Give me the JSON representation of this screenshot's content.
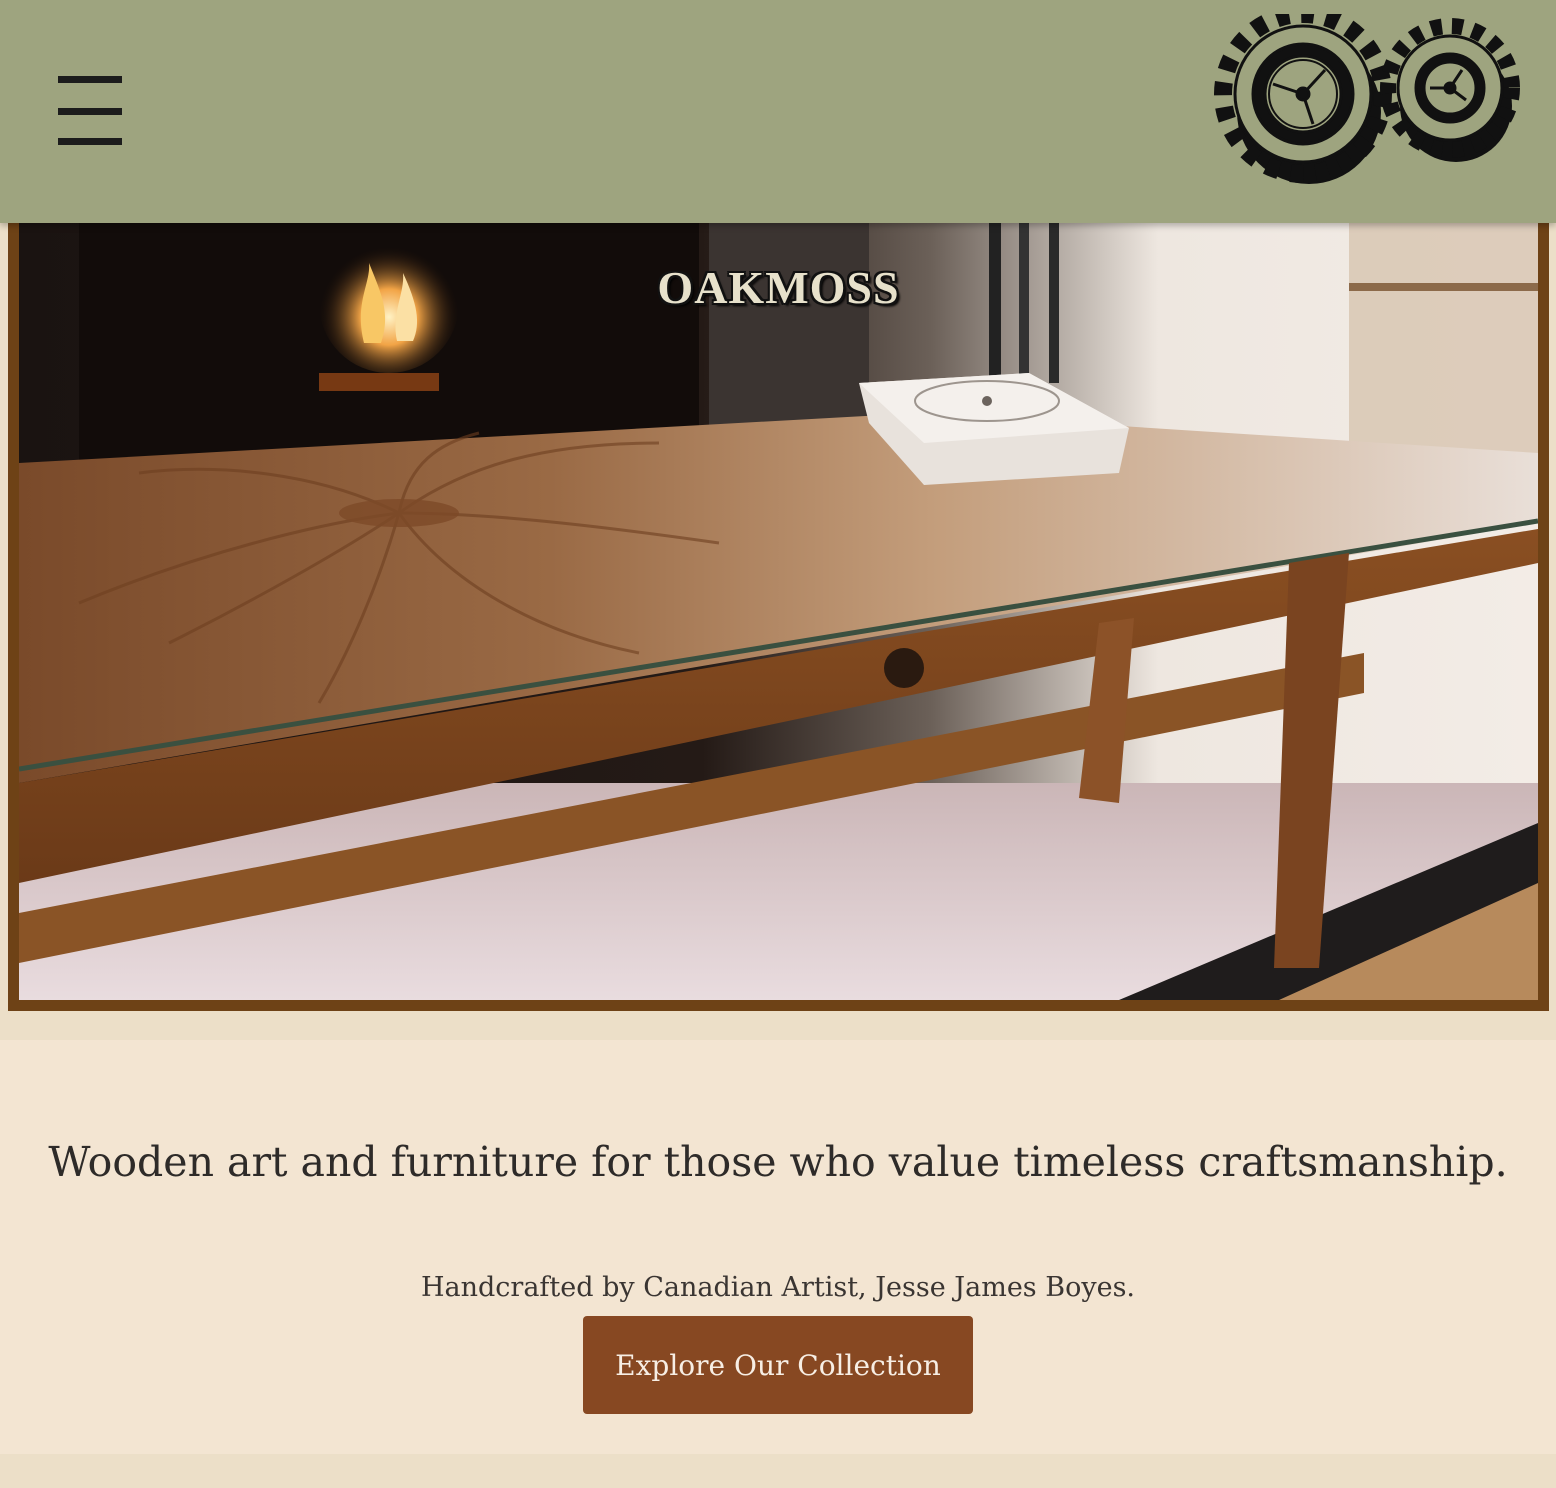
{
  "header": {
    "menu_icon": "hamburger-menu-icon",
    "logo_icon": "gears-logo-icon",
    "background_color": "#9ea47f"
  },
  "hero": {
    "title": "OAKMOSS",
    "image_description_icon": "coffee-table-photo",
    "frame_color": "#6e4216"
  },
  "intro": {
    "tagline": "Wooden art and furniture for those who value timeless craftsmanship.",
    "subline": "Handcrafted by Canadian Artist, Jesse James Boyes.",
    "cta_label": "Explore Our Collection",
    "cta_color": "#874822",
    "background_color": "#f3e5d2"
  }
}
